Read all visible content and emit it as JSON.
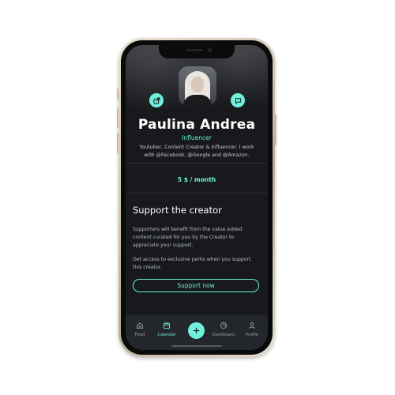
{
  "profile": {
    "name": "Paulina Andrea",
    "role": "Influencer",
    "bio": "Youtuber, Content Creator & Influencer. I work with @Facebook, @Google and @Amazon.",
    "price": "5 $ / month"
  },
  "support": {
    "title": "Support the creator",
    "paragraph1": "Supporters will benefit from the value added content curated for you by the Creator to appreciate your support.",
    "paragraph2": "Get access to exclusive perks when you support this creator.",
    "button_label": "Support now"
  },
  "actions": {
    "share_icon": "share-icon",
    "chat_icon": "chat-icon"
  },
  "tabbar": {
    "items": [
      {
        "label": "Feed",
        "icon": "home-icon"
      },
      {
        "label": "Calendar",
        "icon": "calendar-icon"
      },
      {
        "label": "Dashboard",
        "icon": "pie-chart-icon"
      },
      {
        "label": "Profile",
        "icon": "user-icon"
      }
    ],
    "fab_icon": "plus-icon",
    "active_index": 1
  },
  "colors": {
    "accent": "#6ff0db",
    "background": "#17191c",
    "tabbar": "#23262a"
  }
}
